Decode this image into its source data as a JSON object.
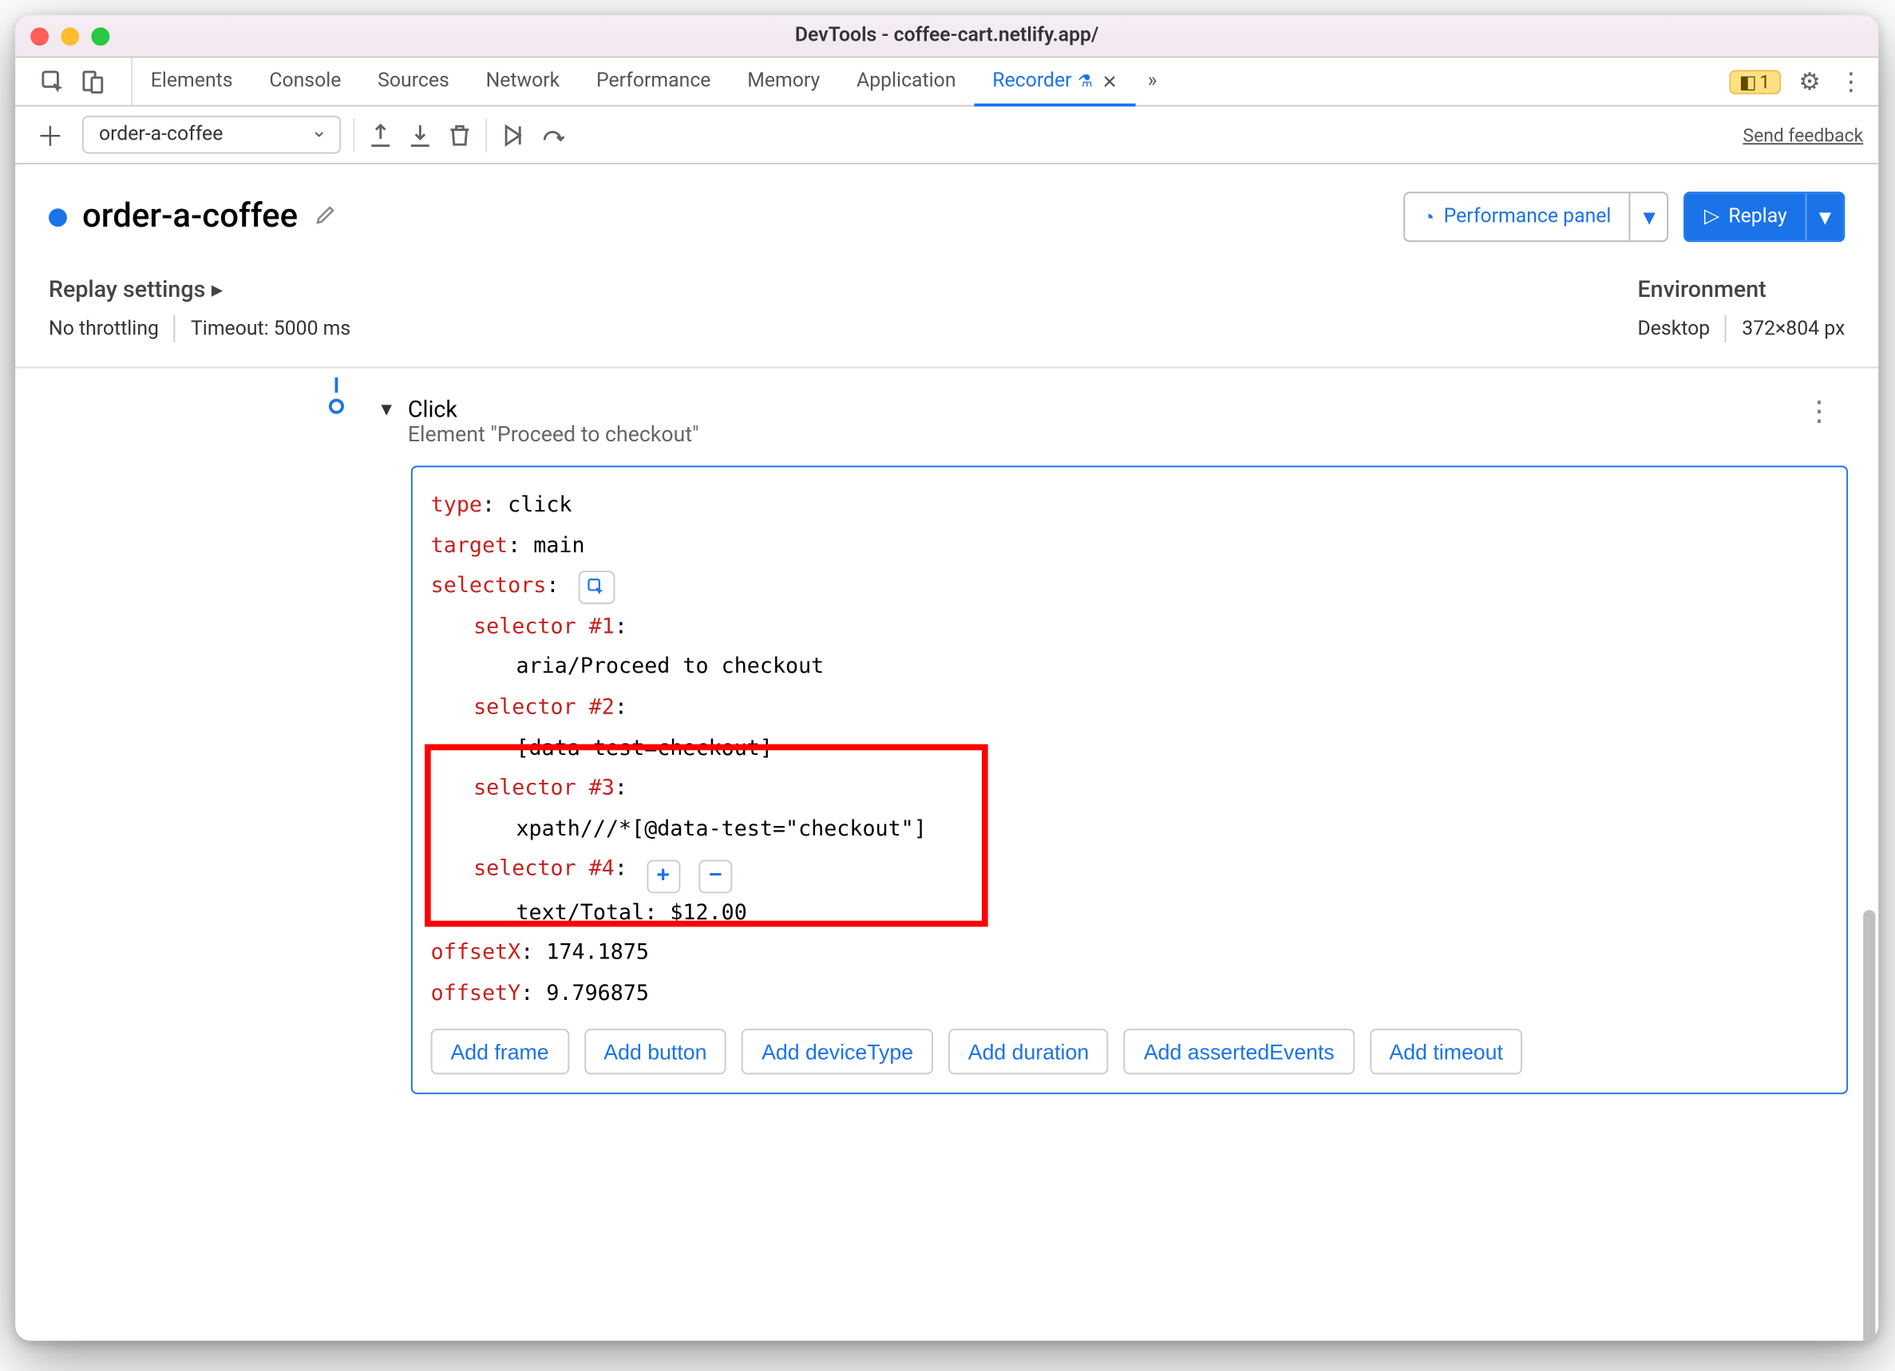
{
  "window": {
    "title": "DevTools - coffee-cart.netlify.app/"
  },
  "tabs": {
    "items": [
      "Elements",
      "Console",
      "Sources",
      "Network",
      "Performance",
      "Memory",
      "Application",
      "Recorder"
    ],
    "active": "Recorder",
    "warning_count": "1"
  },
  "toolbar": {
    "recording_name": "order-a-coffee",
    "feedback": "Send feedback"
  },
  "header": {
    "title": "order-a-coffee",
    "perf_button": "Performance panel",
    "replay_button": "Replay"
  },
  "settings": {
    "replay_title": "Replay settings",
    "throttle": "No throttling",
    "timeout": "Timeout: 5000 ms",
    "env_title": "Environment",
    "device": "Desktop",
    "dimensions": "372×804 px"
  },
  "step": {
    "name": "Click",
    "subtitle": "Element \"Proceed to checkout\"",
    "type_key": "type",
    "type_val": "click",
    "target_key": "target",
    "target_val": "main",
    "selectors_key": "selectors",
    "s1_key": "selector #1",
    "s1_val": "aria/Proceed to checkout",
    "s2_key": "selector #2",
    "s2_val": "[data-test=checkout]",
    "s3_key": "selector #3",
    "s3_val": "xpath///*[@data-test=\"checkout\"]",
    "s4_key": "selector #4",
    "s4_val": "text/Total: $12.00",
    "ox_key": "offsetX",
    "ox_val": "174.1875",
    "oy_key": "offsetY",
    "oy_val": "9.796875",
    "add_buttons": [
      "Add frame",
      "Add button",
      "Add deviceType",
      "Add duration",
      "Add assertedEvents",
      "Add timeout"
    ]
  }
}
